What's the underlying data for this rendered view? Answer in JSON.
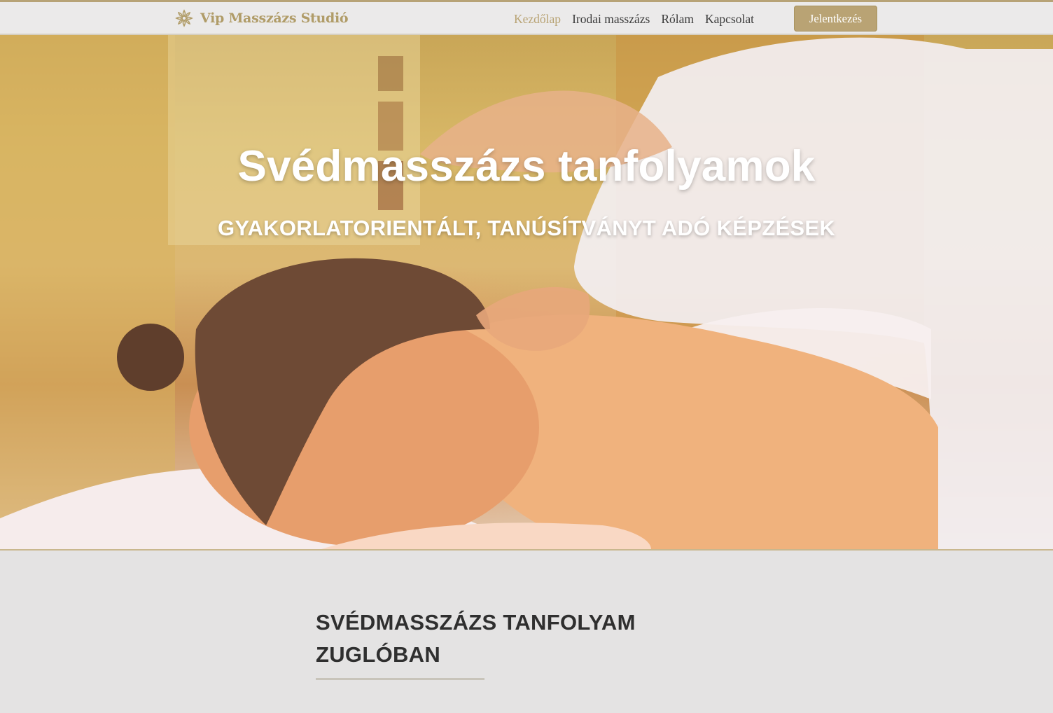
{
  "header": {
    "logo_text": "Vip Masszázs Studió",
    "nav": [
      {
        "label": "Kezdőlap",
        "active": true
      },
      {
        "label": "Irodai masszázs",
        "active": false
      },
      {
        "label": "Rólam",
        "active": false
      },
      {
        "label": "Kapcsolat",
        "active": false
      }
    ],
    "cta_label": "Jelentkezés"
  },
  "hero": {
    "title": "Svédmasszázs tanfolyamok",
    "subtitle": "GYAKORLATORIENTÁLT, TANÚSÍTVÁNYT ADÓ KÉPZÉSEK"
  },
  "section": {
    "title_line1": "SVÉDMASSZÁZS TANFOLYAM",
    "title_line2": "ZUGLÓBAN"
  },
  "colors": {
    "accent": "#b9a374",
    "text_dark": "#2f2f2f",
    "page_bg": "#e4e3e3"
  }
}
